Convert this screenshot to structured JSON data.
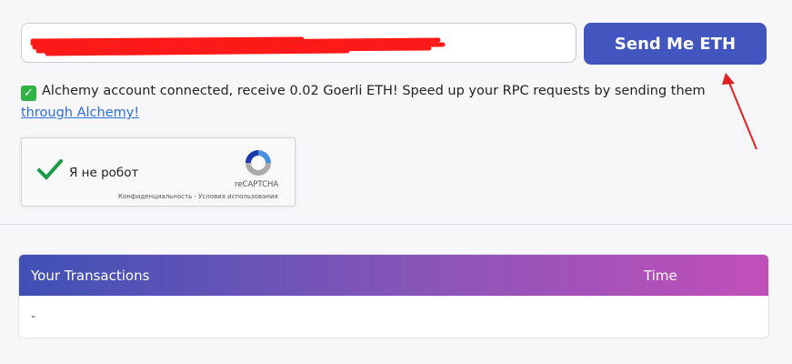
{
  "form": {
    "address_value": "",
    "send_label": "Send Me ETH"
  },
  "notice": {
    "text": "Alchemy account connected, receive 0.02 Goerli ETH! Speed up your RPC requests by sending them ",
    "link": "through Alchemy!",
    "icon": "check-mark-emoji"
  },
  "recaptcha": {
    "label": "Я не робот",
    "brand": "reCAPTCHA",
    "terms": "Конфиденциальность - Условия использования"
  },
  "transactions": {
    "col_tx": "Your Transactions",
    "col_time": "Time",
    "empty": "-"
  }
}
